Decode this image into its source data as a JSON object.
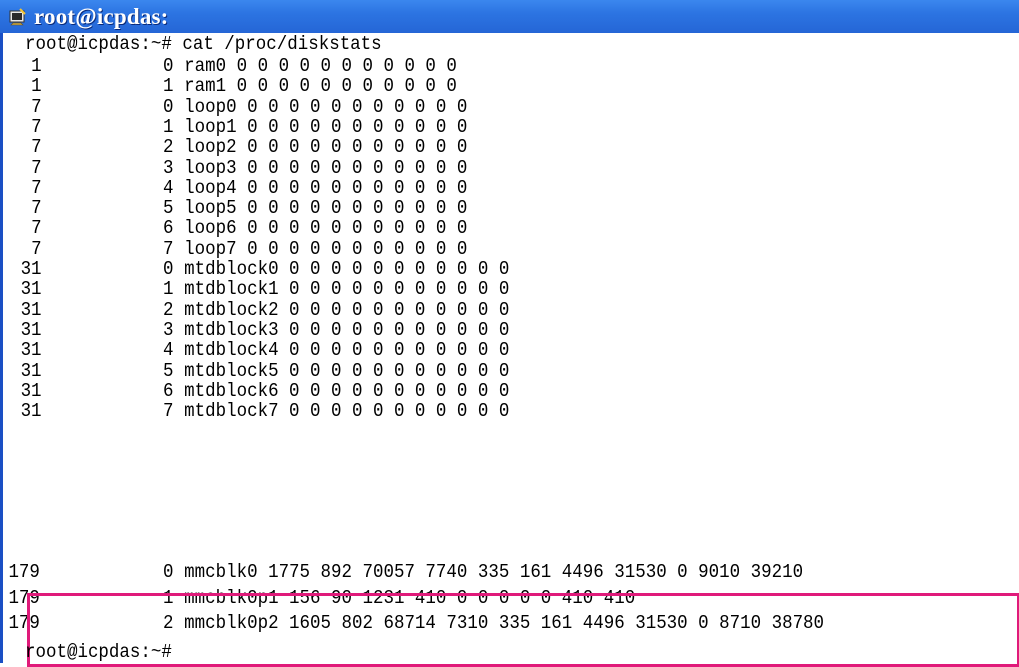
{
  "window": {
    "title": "root@icpdas:",
    "icon": "terminal-icon"
  },
  "terminal": {
    "command_line": "root@icpdas:~# cat /proc/diskstats",
    "prompt_end": "root@icpdas:~#",
    "rows": [
      {
        "major": "1",
        "minor": "0",
        "rest": "ram0 0 0 0 0 0 0 0 0 0 0 0"
      },
      {
        "major": "1",
        "minor": "1",
        "rest": "ram1 0 0 0 0 0 0 0 0 0 0 0"
      },
      {
        "major": "7",
        "minor": "0",
        "rest": "loop0 0 0 0 0 0 0 0 0 0 0 0"
      },
      {
        "major": "7",
        "minor": "1",
        "rest": "loop1 0 0 0 0 0 0 0 0 0 0 0"
      },
      {
        "major": "7",
        "minor": "2",
        "rest": "loop2 0 0 0 0 0 0 0 0 0 0 0"
      },
      {
        "major": "7",
        "minor": "3",
        "rest": "loop3 0 0 0 0 0 0 0 0 0 0 0"
      },
      {
        "major": "7",
        "minor": "4",
        "rest": "loop4 0 0 0 0 0 0 0 0 0 0 0"
      },
      {
        "major": "7",
        "minor": "5",
        "rest": "loop5 0 0 0 0 0 0 0 0 0 0 0"
      },
      {
        "major": "7",
        "minor": "6",
        "rest": "loop6 0 0 0 0 0 0 0 0 0 0 0"
      },
      {
        "major": "7",
        "minor": "7",
        "rest": "loop7 0 0 0 0 0 0 0 0 0 0 0"
      },
      {
        "major": "31",
        "minor": "0",
        "rest": "mtdblock0 0 0 0 0 0 0 0 0 0 0 0"
      },
      {
        "major": "31",
        "minor": "1",
        "rest": "mtdblock1 0 0 0 0 0 0 0 0 0 0 0"
      },
      {
        "major": "31",
        "minor": "2",
        "rest": "mtdblock2 0 0 0 0 0 0 0 0 0 0 0"
      },
      {
        "major": "31",
        "minor": "3",
        "rest": "mtdblock3 0 0 0 0 0 0 0 0 0 0 0"
      },
      {
        "major": "31",
        "minor": "4",
        "rest": "mtdblock4 0 0 0 0 0 0 0 0 0 0 0"
      },
      {
        "major": "31",
        "minor": "5",
        "rest": "mtdblock5 0 0 0 0 0 0 0 0 0 0 0"
      },
      {
        "major": "31",
        "minor": "6",
        "rest": "mtdblock6 0 0 0 0 0 0 0 0 0 0 0"
      },
      {
        "major": "31",
        "minor": "7",
        "rest": "mtdblock7 0 0 0 0 0 0 0 0 0 0 0"
      }
    ],
    "highlighted_rows": [
      {
        "major": "179",
        "minor": "0",
        "rest": "mmcblk0 1775 892 70057 7740 335 161 4496 31530 0 9010 39210"
      },
      {
        "major": "179",
        "minor": "1",
        "rest": "mmcblk0p1 156 90 1231 410 0 0 0 0 0 410 410"
      },
      {
        "major": "179",
        "minor": "2",
        "rest": "mmcblk0p2 1605 802 68714 7310 335 161 4496 31530 0 8710 38780"
      }
    ],
    "highlight_color": "#e01a7a"
  }
}
